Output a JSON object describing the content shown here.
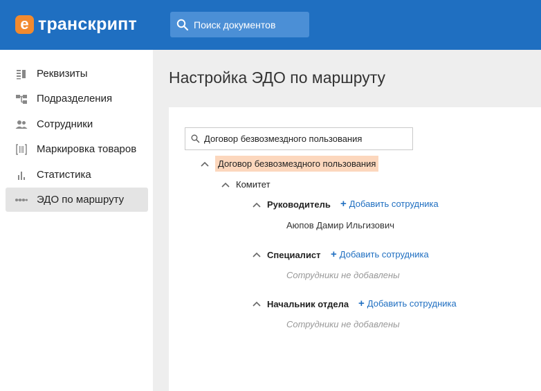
{
  "header": {
    "logo_letter": "е",
    "logo_text": "транскрипт",
    "search_label": "Поиск документов"
  },
  "sidebar": {
    "items": [
      {
        "label": "Реквизиты",
        "icon": "requisites-icon"
      },
      {
        "label": "Подразделения",
        "icon": "org-structure-icon"
      },
      {
        "label": "Сотрудники",
        "icon": "people-icon"
      },
      {
        "label": "Маркировка товаров",
        "icon": "barcode-icon"
      },
      {
        "label": "Статистика",
        "icon": "bar-chart-icon"
      },
      {
        "label": "ЭДО по маршруту",
        "icon": "route-icon",
        "active": true
      }
    ]
  },
  "main": {
    "title": "Настройка ЭДО по маршруту",
    "filter_value": "Договор безвозмездного пользования",
    "tree": {
      "root": "Договор безвозмездного пользования",
      "department": "Комитет",
      "add_label": "Добавить сотрудника",
      "roles": [
        {
          "name": "Руководитель",
          "employees": [
            "Аюпов Дамир Ильгизович"
          ]
        },
        {
          "name": "Специалист",
          "empty_text": "Сотрудники не добавлены"
        },
        {
          "name": "Начальник отдела",
          "empty_text": "Сотрудники не добавлены"
        }
      ]
    }
  },
  "colors": {
    "header_bg": "#1f6fc1",
    "logo_accent": "#f28a2e",
    "link": "#1f6fc1",
    "highlight": "#fcd7bd"
  }
}
